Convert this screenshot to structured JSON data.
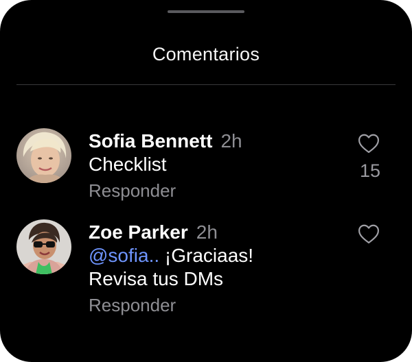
{
  "sheet": {
    "title": "Comentarios"
  },
  "comments": [
    {
      "author": "Sofia Bennett",
      "time": "2h",
      "text": "Checklist",
      "reply_label": "Responder",
      "like_count": "15"
    },
    {
      "author": "Zoe Parker",
      "time": "2h",
      "mention": "@sofia..",
      "text_line1": " ¡Graciaas!",
      "text_line2": "Revisa tus DMs",
      "reply_label": "Responder"
    }
  ],
  "colors": {
    "background": "#000000",
    "text": "#ffffff",
    "muted": "#8e8e93",
    "mention": "#6f95ff"
  },
  "icons": {
    "like": "heart-outline-icon"
  }
}
